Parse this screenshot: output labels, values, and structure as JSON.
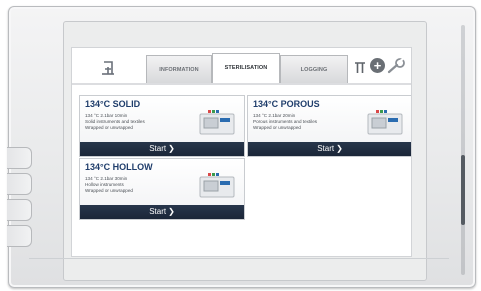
{
  "tabs": [
    {
      "label": "INFORMATION"
    },
    {
      "label": "STERILISATION"
    },
    {
      "label": "LOGGING"
    }
  ],
  "active_tab": "STERILISATION",
  "toolbar": {
    "exit_icon": "exit-door-icon",
    "filter_icon": "filter-icon",
    "add_icon": "plus-circle-icon",
    "tools_icon": "wrench-icon"
  },
  "programs": [
    {
      "title": "134°C SOLID",
      "specs": "134 °C  2.1bar  10min",
      "desc": "Solid instruments and textiles",
      "wrap": "Wrapped or unwrapped",
      "start": "Start"
    },
    {
      "title": "134°C POROUS",
      "specs": "134 °C  2.1bar  20min",
      "desc": "Porous instruments and textiles",
      "wrap": "Wrapped or unwrapped",
      "start": "Start"
    },
    {
      "title": "134°C HOLLOW",
      "specs": "134 °C  2.1bar  30min",
      "desc": "Hollow instruments",
      "wrap": "Wrapped or unwrapped",
      "start": "Start"
    }
  ],
  "colors": {
    "accent": "#1f3d6b",
    "start_bar": "#1b2638",
    "tab_bg": "#d7d8da"
  }
}
